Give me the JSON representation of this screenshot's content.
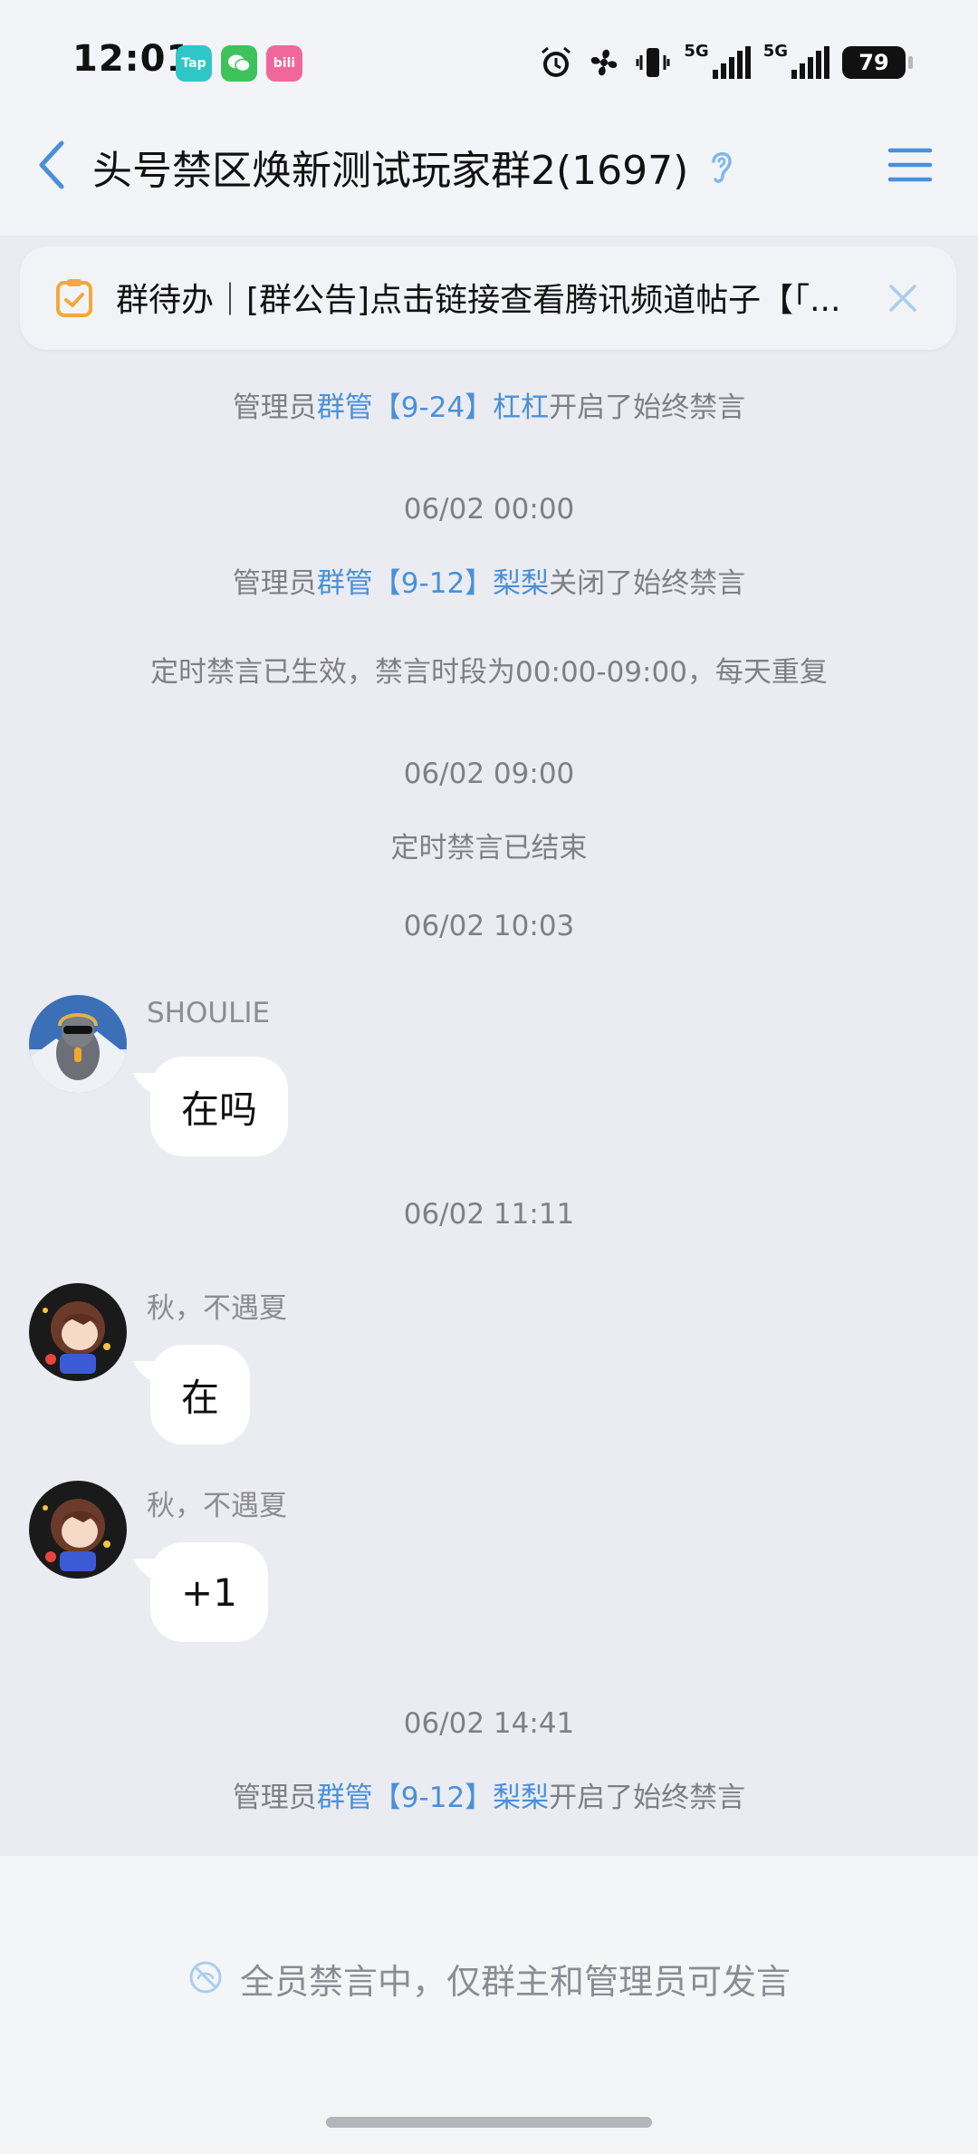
{
  "status_bar": {
    "time": "12:01",
    "apps": [
      "Tap",
      "WeChat",
      "bilibili"
    ],
    "app_labels": [
      "Tap",
      "",
      "bili"
    ],
    "network_labels": [
      "5G",
      "5G"
    ],
    "battery": "79"
  },
  "header": {
    "title": "头号禁区焕新测试玩家群2(1697)"
  },
  "todo": {
    "text": "群待办｜[群公告]点击链接查看腾讯频道帖子【「..."
  },
  "messages": {
    "sys1": {
      "prefix": "管理员",
      "link": "群管【9-24】杠杠",
      "suffix": "开启了始终禁言"
    },
    "time1": "06/02 00:00",
    "sys2": {
      "prefix": "管理员",
      "link": "群管【9-12】梨梨",
      "suffix": "关闭了始终禁言"
    },
    "sys3": "定时禁言已生效，禁言时段为00:00-09:00，每天重复",
    "time2": "06/02 09:00",
    "sys4": "定时禁言已结束",
    "time3": "06/02 10:03",
    "chat1": {
      "sender": "SHOULIE",
      "text": "在吗"
    },
    "time4": "06/02 11:11",
    "chat2": {
      "sender": "秋，不遇夏",
      "text": "在"
    },
    "chat3": {
      "sender": "秋，不遇夏",
      "text": "+1"
    },
    "time5": "06/02 14:41",
    "sys5": {
      "prefix": "管理员",
      "link": "群管【9-12】梨梨",
      "suffix": "开启了始终禁言"
    }
  },
  "footer": {
    "mute_notice": "全员禁言中，仅群主和管理员可发言"
  },
  "colors": {
    "accent": "#4a90d9",
    "background": "#eaecf2",
    "system_text": "#7d8086"
  }
}
